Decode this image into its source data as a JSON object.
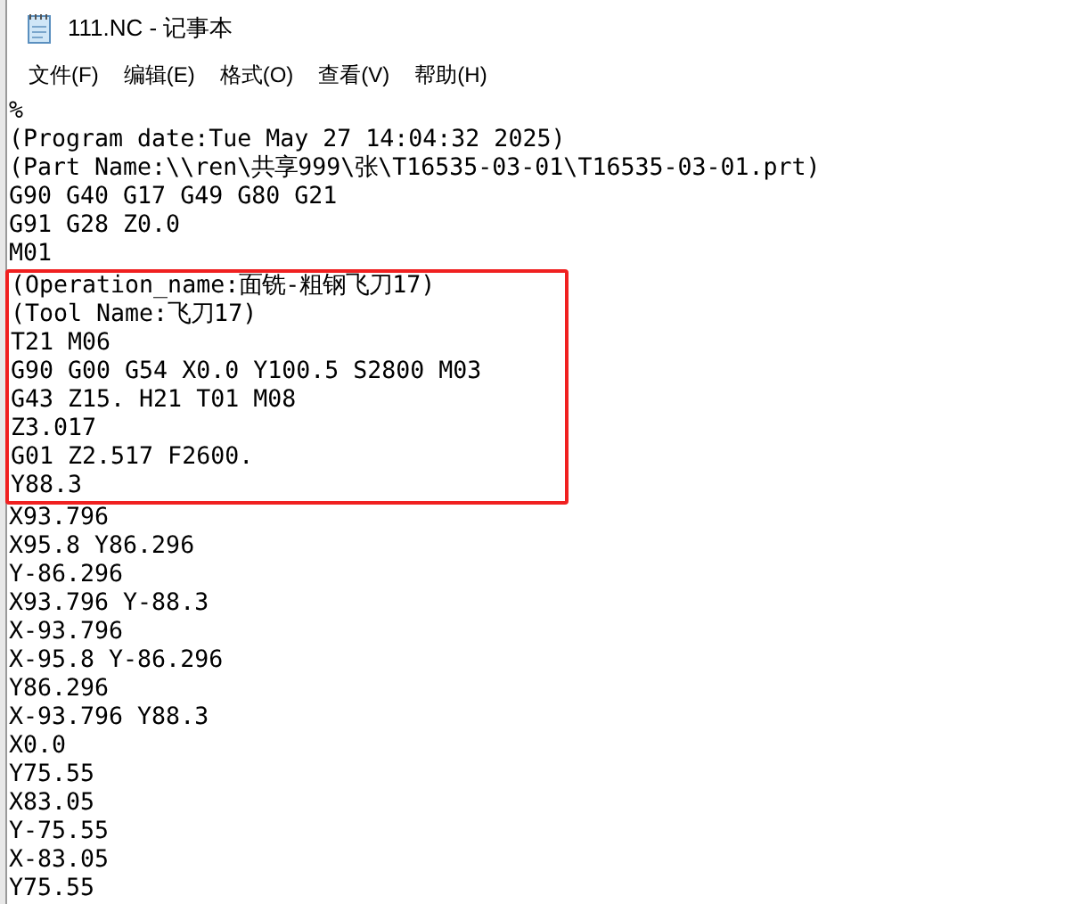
{
  "window": {
    "title": "111.NC - 记事本"
  },
  "menu": [
    "文件(F)",
    "编辑(E)",
    "格式(O)",
    "查看(V)",
    "帮助(H)"
  ],
  "sections": [
    {
      "kind": "plain",
      "lines": [
        "%",
        "(Program date:Tue May 27 14:04:32 2025)",
        "(Part Name:\\\\ren\\共享999\\张\\T16535-03-01\\T16535-03-01.prt)",
        "G90 G40 G17 G49 G80 G21",
        "G91 G28 Z0.0",
        "M01"
      ]
    },
    {
      "kind": "highlighted",
      "lines": [
        "(Operation_name:面铣-粗钢飞刀17)",
        "(Tool Name:飞刀17)",
        "T21 M06",
        "G90 G00 G54 X0.0 Y100.5 S2800 M03",
        "G43 Z15. H21 T01 M08",
        "Z3.017",
        "G01 Z2.517 F2600.",
        "Y88.3"
      ]
    },
    {
      "kind": "plain",
      "lines": [
        "X93.796",
        "X95.8 Y86.296",
        "Y-86.296",
        "X93.796 Y-88.3",
        "X-93.796",
        "X-95.8 Y-86.296",
        "Y86.296",
        "X-93.796 Y88.3",
        "X0.0",
        "Y75.55",
        "X83.05",
        "Y-75.55",
        "X-83.05",
        "Y75.55"
      ]
    }
  ]
}
